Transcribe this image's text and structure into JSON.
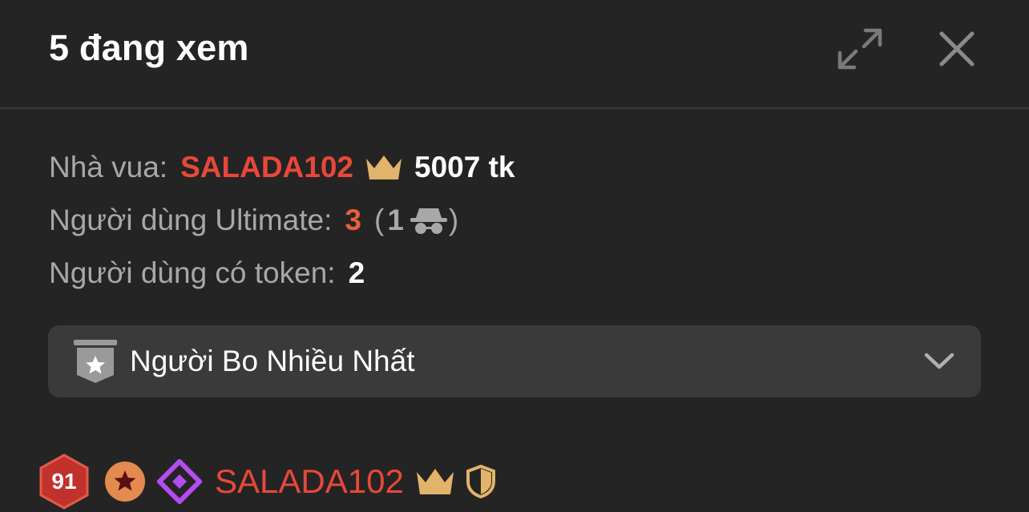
{
  "header": {
    "title": "5 đang xem",
    "expand_icon": "expand-icon",
    "close_icon": "close-icon"
  },
  "stats": {
    "king_label": "Nhà vua:",
    "king_name": "SALADA102",
    "king_tokens": "5007 tk",
    "ultimate_label": "Người dùng Ultimate:",
    "ultimate_count": "3",
    "paren_open": "(",
    "anonymous_count": "1",
    "paren_close": ")",
    "token_users_label": "Người dùng có token:",
    "token_users_count": "2"
  },
  "dropdown": {
    "selected": "Người Bo Nhiều Nhất",
    "icon": "shield-star-icon"
  },
  "users": [
    {
      "level": "91",
      "username": "SALADA102"
    }
  ],
  "colors": {
    "background": "#242424",
    "accent_red": "#e8483a",
    "ultimate_orange": "#e8603a",
    "crown_gold": "#e2b36a",
    "muted_text": "#a8a8a8",
    "dropdown_bg": "#3a3a3a",
    "purple_badge": "#b44cf0"
  }
}
